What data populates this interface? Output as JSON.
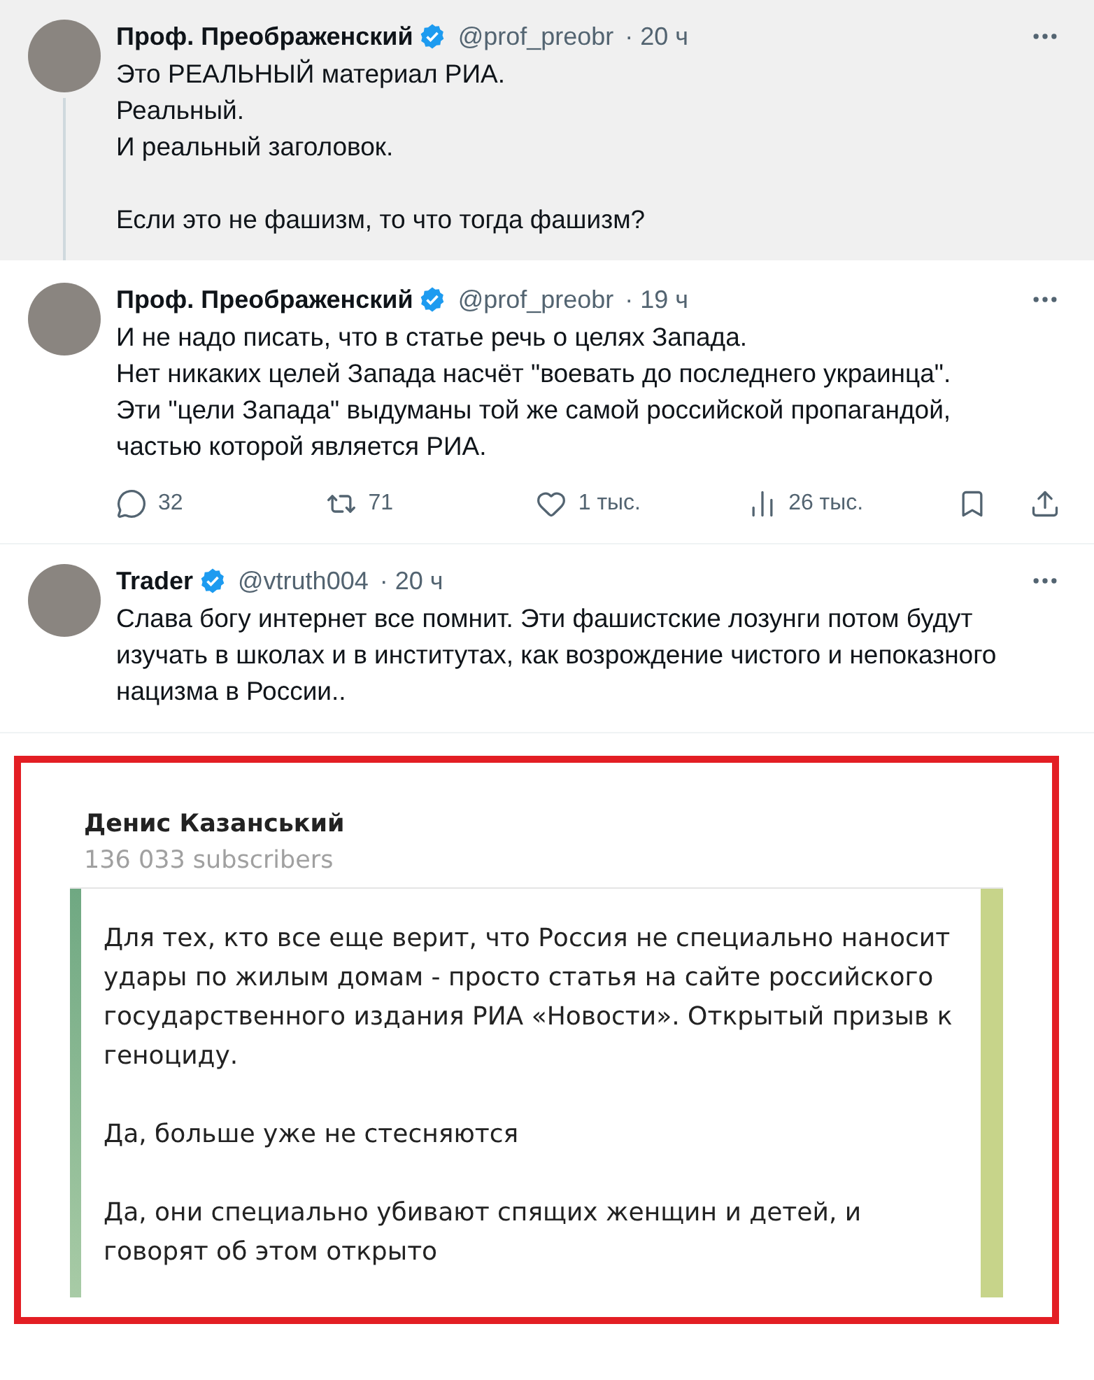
{
  "tweets": [
    {
      "name": "Проф. Преображенский",
      "verified": true,
      "handle": "@prof_preobr",
      "time": "· 20 ч",
      "highlighted": true,
      "thread_line": true,
      "paragraphs": [
        "Это РЕАЛЬНЫЙ материал РИА.\nРеальный.\nИ реальный заголовок.",
        "Если это не фашизм, то что тогда фашизм?"
      ]
    },
    {
      "name": "Проф. Преображенский",
      "verified": true,
      "handle": "@prof_preobr",
      "time": "· 19 ч",
      "highlighted": false,
      "thread_line": false,
      "paragraphs": [
        "И не надо писать, что в статье речь о целях Запада.\nНет никаких целей Запада насчёт \"воевать до последнего украинца\".\nЭти \"цели Запада\" выдуманы той же самой российской пропагандой, частью которой является РИА."
      ],
      "actions": [
        {
          "kind": "reply",
          "count": "32"
        },
        {
          "kind": "repost",
          "count": "71"
        },
        {
          "kind": "like",
          "count": "1 тыс."
        },
        {
          "kind": "views",
          "count": "26 тыс."
        },
        {
          "kind": "bookmark"
        },
        {
          "kind": "share"
        }
      ]
    },
    {
      "name": "Trader",
      "verified": true,
      "handle": "@vtruth004",
      "time": "· 20 ч",
      "highlighted": false,
      "thread_line": false,
      "paragraphs": [
        "Слава богу интернет все помнит. Эти фашистские лозунги потом будут изучать в школах и в институтах, как возрождение чистого и непоказного нацизма в России.."
      ]
    }
  ],
  "channel_post": {
    "channel": "Денис Казанський",
    "subscribers": "136 033 subscribers",
    "paragraphs": [
      "Для тех, кто все еще верит, что Россия не специально наносит удары по жилым домам - просто статья на сайте российского государственного издания РИА «Новости». Открытый призыв к геноциду.",
      "Да, больше уже не стесняются",
      "Да, они специально убивают спящих женщин и детей, и говорят об этом открыто"
    ]
  }
}
